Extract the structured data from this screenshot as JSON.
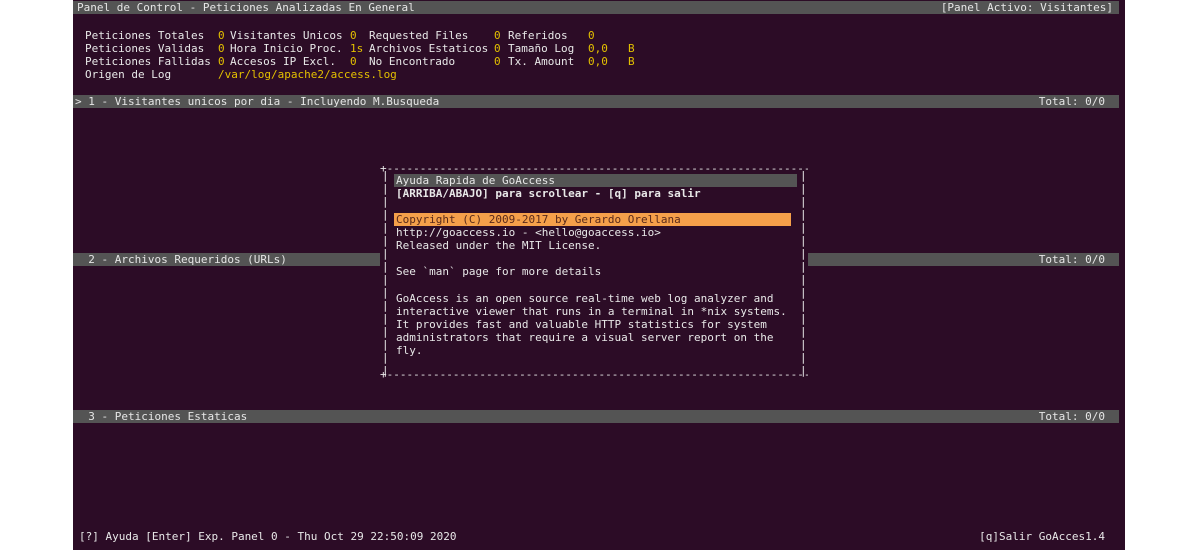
{
  "header": {
    "title": "Panel de Control - Peticiones Analizadas En General",
    "active_panel": "[Panel Activo: Visitantes]"
  },
  "stats": {
    "row1": [
      {
        "label": "Peticiones Totales",
        "value": "0"
      },
      {
        "label": "Visitantes Unicos",
        "value": "0"
      },
      {
        "label": "Requested Files",
        "value": "0"
      },
      {
        "label": "Referidos",
        "value": "0"
      }
    ],
    "row2": [
      {
        "label": "Peticiones Validas",
        "value": "0"
      },
      {
        "label": "Hora Inicio Proc.",
        "value": "1s"
      },
      {
        "label": "Archivos Estaticos",
        "value": "0"
      },
      {
        "label": "Tamaño Log",
        "value": "0,0",
        "unit": "B"
      }
    ],
    "row3": [
      {
        "label": "Peticiones Fallidas",
        "value": "0"
      },
      {
        "label": "Accesos IP Excl.",
        "value": "0"
      },
      {
        "label": "No Encontrado",
        "value": "0"
      },
      {
        "label": "Tx. Amount",
        "value": "0,0",
        "unit": "B"
      }
    ],
    "log_origin_label": "Origen de Log",
    "log_origin_value": "/var/log/apache2/access.log"
  },
  "panels": [
    {
      "label": "> 1 - Visitantes unicos por dia - Incluyendo M.Busqueda",
      "total": "Total: 0/0"
    },
    {
      "label": "  2 - Archivos Requeridos (URLs)",
      "total": "Total: 0/0"
    },
    {
      "label": "  3 - Peticiones Estaticas",
      "total": "Total: 0/0"
    }
  ],
  "help": {
    "title": "Ayuda Rapida de GoAccess",
    "subtitle": "[ARRIBA/ABAJO] para scrollear - [q] para salir",
    "copyright": "Copyright (C) 2009-2017 by Gerardo Orellana",
    "website": "http://goaccess.io - <hello@goaccess.io>",
    "license": "Released under the MIT License.",
    "man_hint": "See `man` page for more details",
    "description": [
      "GoAccess is an open source real-time web log analyzer and",
      "interactive viewer that runs in a terminal in *nix systems.",
      "It provides fast and valuable HTTP statistics for system",
      "administrators that require a visual server report on the",
      "fly."
    ]
  },
  "footer": {
    "left": "[?] Ayuda [Enter] Exp. Panel 0 - Thu Oct 29 22:50:09 2020",
    "right": "[q]Salir GoAcces1.4"
  },
  "colors": {
    "background": "#2c0c26",
    "bar": "#545454",
    "value": "#e3c000",
    "highlight": "#f5a04a"
  }
}
